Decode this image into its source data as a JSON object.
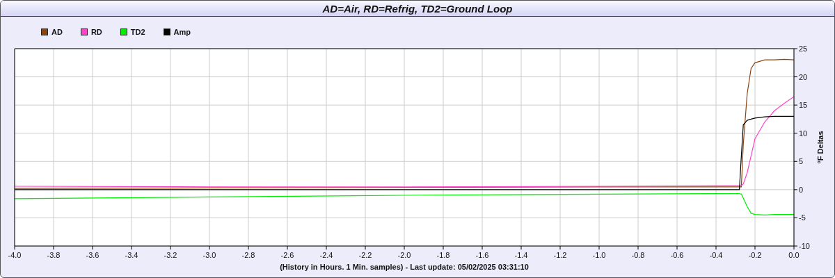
{
  "window": {
    "title": "AD=Air, RD=Refrig, TD2=Ground Loop"
  },
  "chart_data": {
    "type": "line",
    "xlabel": "(History in Hours. 1 Min. samples) - Last update: 05/02/2025 03:31:10",
    "ylabel": "°F Deltas",
    "x": [
      -4.0,
      -3.0,
      -2.0,
      -1.0,
      -0.3,
      -0.28,
      -0.27,
      -0.26,
      -0.24,
      -0.22,
      -0.2,
      -0.15,
      -0.1,
      -0.05,
      0.0
    ],
    "series": [
      {
        "name": "AD",
        "color": "#8b4513",
        "values": [
          0.2,
          0.3,
          0.4,
          0.5,
          0.5,
          0.5,
          0.5,
          8,
          17,
          21.5,
          22.5,
          23,
          23,
          23.1,
          23
        ]
      },
      {
        "name": "RD",
        "color": "#ff44cc",
        "values": [
          0.6,
          0.5,
          0.5,
          0.6,
          0.7,
          0.7,
          0.7,
          1,
          3,
          6,
          9,
          12,
          14,
          15.3,
          16.5
        ]
      },
      {
        "name": "TD2",
        "color": "#00ee00",
        "values": [
          -1.6,
          -1.3,
          -1.0,
          -0.8,
          -0.7,
          -0.7,
          -0.8,
          -1.5,
          -3,
          -4.2,
          -4.4,
          -4.5,
          -4.4,
          -4.4,
          -4.4
        ]
      },
      {
        "name": "Amp",
        "color": "#000000",
        "values": [
          0,
          0,
          0,
          0,
          0,
          0,
          6,
          11.5,
          12.3,
          12.5,
          12.7,
          12.9,
          13,
          13,
          13
        ]
      }
    ],
    "xlim": [
      -4.0,
      0.0
    ],
    "ylim": [
      -10,
      25
    ],
    "xticks": [
      {
        "value": -4.0,
        "label": "-4.0"
      },
      {
        "value": -3.8,
        "label": "-3.8"
      },
      {
        "value": -3.6,
        "label": "-3.6"
      },
      {
        "value": -3.4,
        "label": "-3.4"
      },
      {
        "value": -3.2,
        "label": "-3.2"
      },
      {
        "value": -3.0,
        "label": "-3.0"
      },
      {
        "value": -2.8,
        "label": "-2.8"
      },
      {
        "value": -2.6,
        "label": "-2.6"
      },
      {
        "value": -2.4,
        "label": "-2.4"
      },
      {
        "value": -2.2,
        "label": "-2.2"
      },
      {
        "value": -2.0,
        "label": "-2.0"
      },
      {
        "value": -1.8,
        "label": "-1.8"
      },
      {
        "value": -1.6,
        "label": "-1.6"
      },
      {
        "value": -1.4,
        "label": "-1.4"
      },
      {
        "value": -1.2,
        "label": "-1.2"
      },
      {
        "value": -1.0,
        "label": "-1.0"
      },
      {
        "value": -0.8,
        "label": "-0.8"
      },
      {
        "value": -0.6,
        "label": "-0.6"
      },
      {
        "value": -0.4,
        "label": "-0.4"
      },
      {
        "value": -0.2,
        "label": "-0.2"
      },
      {
        "value": 0.0,
        "label": "0.0"
      }
    ],
    "yticks": [
      -10,
      -5,
      0,
      5,
      10,
      15,
      20,
      25
    ],
    "grid": true
  }
}
